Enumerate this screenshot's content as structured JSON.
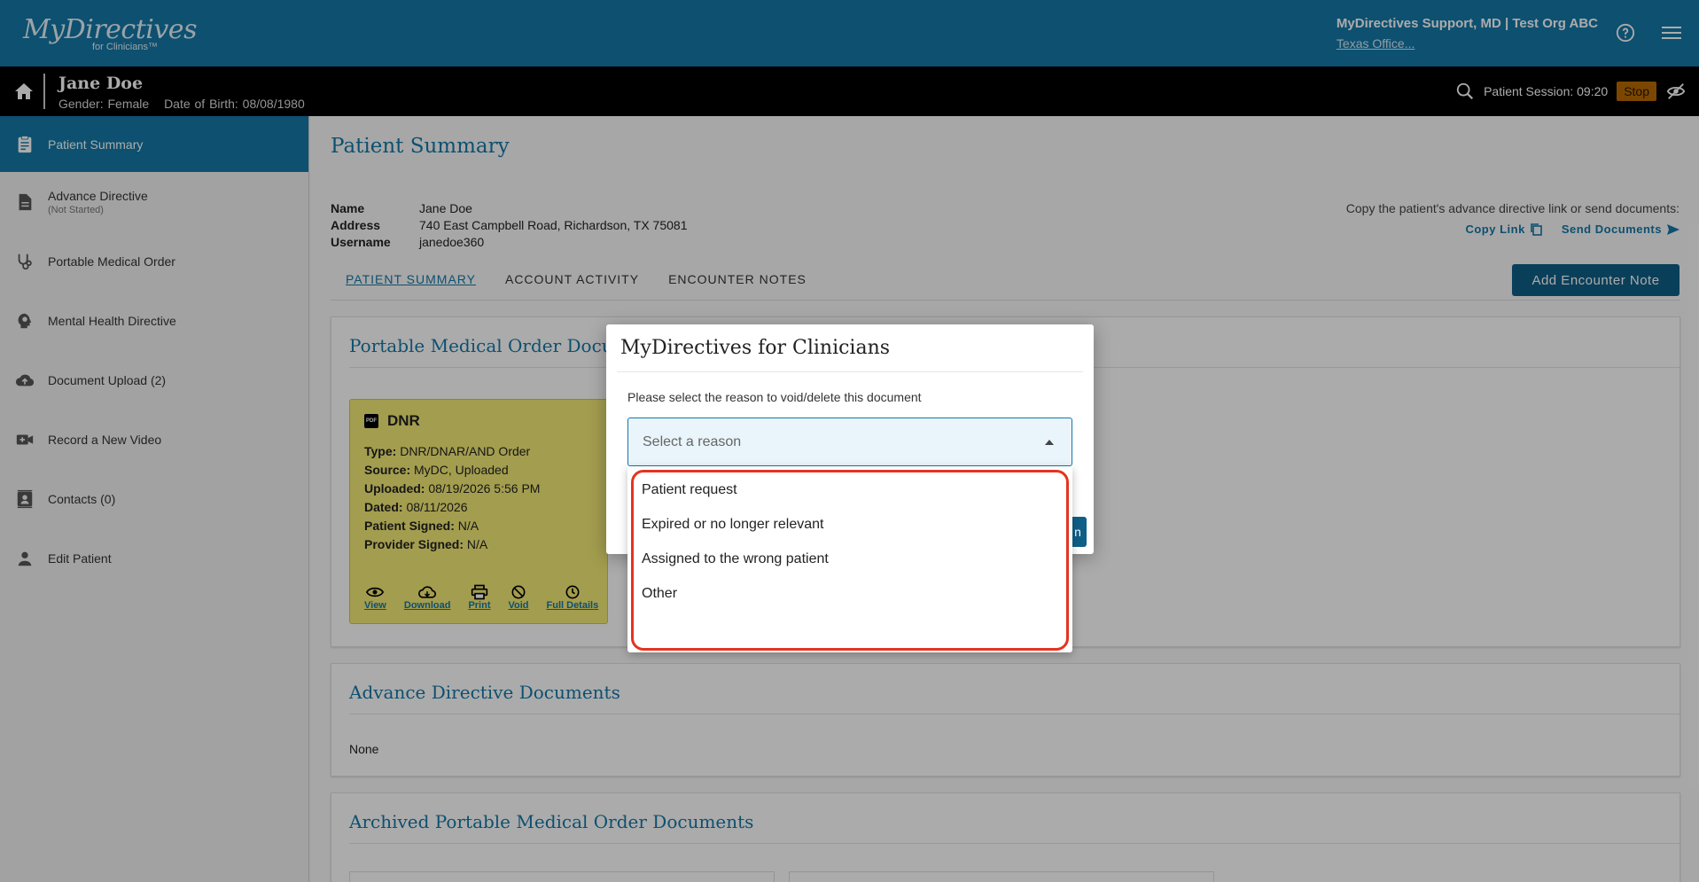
{
  "app": {
    "brand": "MyDirectives",
    "brand_sub": "for Clinicians™",
    "user_line": "MyDirectives Support, MD | Test Org ABC",
    "org_link": "Texas Office..."
  },
  "patient_bar": {
    "name": "Jane Doe",
    "gender": "Gender: Female",
    "dob": "Date of Birth: 08/08/1980",
    "session": "Patient Session: 09:20",
    "stop_label": "Stop"
  },
  "sidebar": {
    "items": [
      {
        "label": "Patient Summary",
        "sub": ""
      },
      {
        "label": "Advance Directive",
        "sub": "(Not Started)"
      },
      {
        "label": "Portable Medical Order",
        "sub": ""
      },
      {
        "label": "Mental Health Directive",
        "sub": ""
      },
      {
        "label": "Document Upload (2)",
        "sub": ""
      },
      {
        "label": "Record a New Video",
        "sub": ""
      },
      {
        "label": "Contacts (0)",
        "sub": ""
      },
      {
        "label": "Edit Patient",
        "sub": ""
      }
    ]
  },
  "main": {
    "title": "Patient Summary",
    "info": {
      "name_label": "Name",
      "name": "Jane Doe",
      "address_label": "Address",
      "address": "740 East Campbell Road, Richardson, TX 75081",
      "username_label": "Username",
      "username": "janedoe360"
    },
    "copy_prompt": "Copy the patient's advance directive link or send documents:",
    "copy_link": "Copy Link",
    "send_documents": "Send Documents",
    "tabs": [
      "PATIENT SUMMARY",
      "ACCOUNT ACTIVITY",
      "ENCOUNTER NOTES"
    ],
    "add_note": "Add Encounter Note",
    "sections": {
      "pmo_title": "Portable Medical Order Docum",
      "ad_title": "Advance Directive Documents",
      "ad_none": "None",
      "archived_title": "Archived Portable Medical Order Documents"
    },
    "doc": {
      "pdf": "PDF",
      "title": "DNR",
      "type_label": "Type:",
      "type": "DNR/DNAR/AND Order",
      "source_label": "Source:",
      "source": "MyDC, Uploaded",
      "uploaded_label": "Uploaded:",
      "uploaded": "08/19/2026 5:56 PM",
      "dated_label": "Dated:",
      "dated": "08/11/2026",
      "patient_signed_label": "Patient Signed:",
      "patient_signed": "N/A",
      "provider_signed_label": "Provider Signed:",
      "provider_signed": "N/A",
      "actions": [
        "View",
        "Download",
        "Print",
        "Void",
        "Full Details"
      ]
    }
  },
  "modal": {
    "title": "MyDirectives for Clinicians",
    "prompt": "Please select the reason to void/delete this document",
    "select_placeholder": "Select a reason",
    "button_fragment": "n",
    "options": [
      "Patient request",
      "Expired or no longer relevant",
      "Assigned to the wrong patient",
      "Other"
    ],
    "highlight_color": "#e53320"
  }
}
